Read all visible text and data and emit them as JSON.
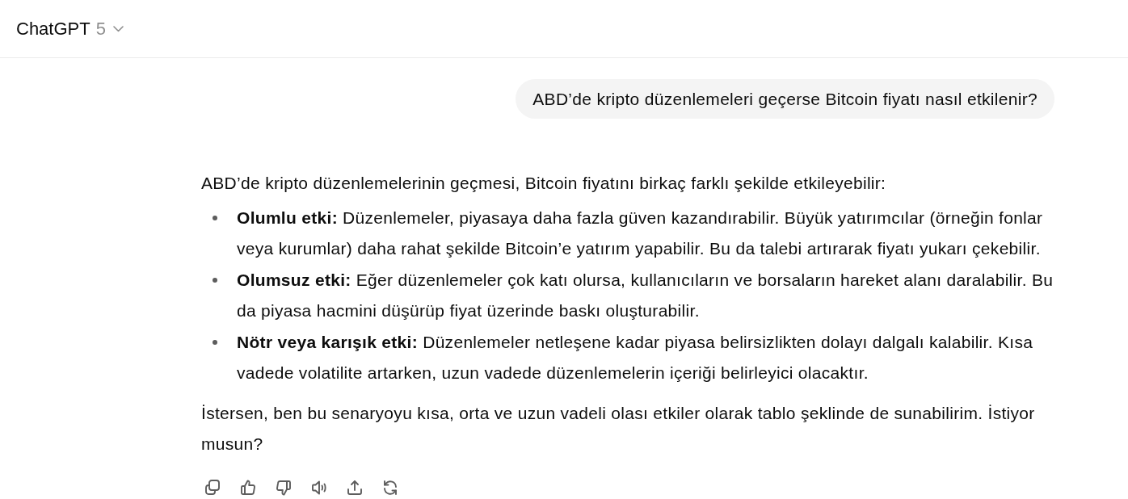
{
  "header": {
    "title": "ChatGPT",
    "version": "5"
  },
  "user_message": {
    "text": "ABD’de kripto düzenlemeleri geçerse Bitcoin fiyatı nasıl etkilenir?"
  },
  "assistant_message": {
    "intro": "ABD’de kripto düzenlemelerinin geçmesi, Bitcoin fiyatını birkaç farklı şekilde etkileyebilir:",
    "bullets": [
      "**Olumlu etki:** Düzenlemeler, piyasaya daha fazla güven kazandırabilir. Büyük yatırımcılar (örneğin fonlar veya kurumlar) daha rahat şekilde Bitcoin’e yatırım yapabilir. Bu da talebi artırarak fiyatı yukarı çekebilir.",
      "**Olumsuz etki:** Eğer düzenlemeler çok katı olursa, kullanıcıların ve borsaların hareket alanı daralabilir. Bu da piyasa hacmini düşürüp fiyat üzerinde baskı oluşturabilir.",
      "**Nötr veya karışık etki:** Düzenlemeler netleşene kadar piyasa belirsizlikten dolayı dalgalı kalabilir. Kısa vadede volatilite artarken, uzun vadede düzenlemelerin içeriği belirleyici olacaktır."
    ],
    "outro": "İstersen, ben bu senaryoyu kısa, orta ve uzun vadeli olası etkiler olarak tablo şeklinde de sunabilirim. İstiyor musun?"
  }
}
